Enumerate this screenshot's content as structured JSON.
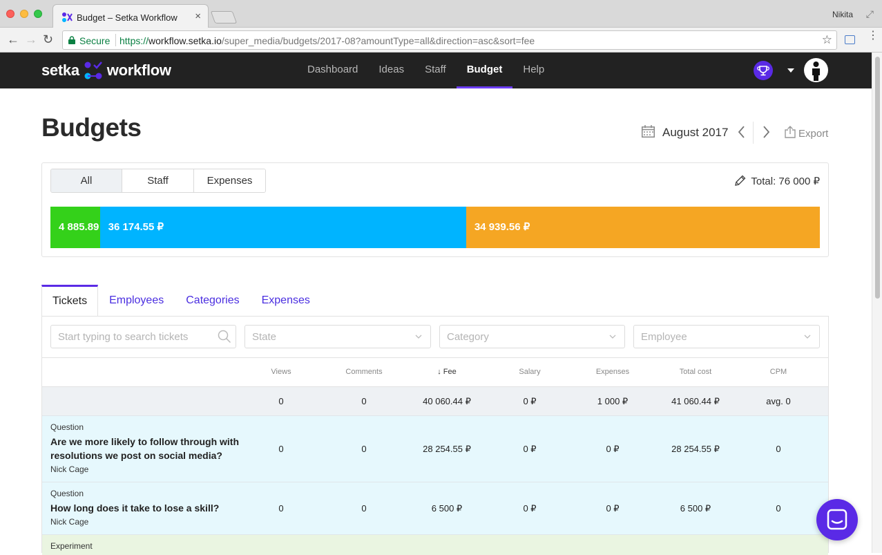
{
  "browser": {
    "tab_title": "Budget – Setka Workflow",
    "tab_close": "×",
    "user_name": "Nikita",
    "secure_label": "Secure",
    "url_scheme": "https://",
    "url_host": "workflow.setka.io",
    "url_path": "/super_media/budgets/2017-08?amountType=all&direction=asc&sort=fee",
    "back_icon": "←",
    "forward_icon": "→",
    "reload_icon": "↻",
    "star_icon": "☆",
    "menu_icon": "⋮",
    "fullscreen_icon": "⤢"
  },
  "header": {
    "logo_left": "setka",
    "logo_right": "workflow",
    "nav": [
      {
        "label": "Dashboard"
      },
      {
        "label": "Ideas"
      },
      {
        "label": "Staff"
      },
      {
        "label": "Budget",
        "active": true
      },
      {
        "label": "Help"
      }
    ],
    "accent_color": "#5a2ae6"
  },
  "page": {
    "title": "Budgets",
    "month": "August 2017",
    "export_label": "Export"
  },
  "summary": {
    "segments": [
      {
        "label": "All",
        "active": true
      },
      {
        "label": "Staff"
      },
      {
        "label": "Expenses"
      }
    ],
    "total_label": "Total: 76 000 ₽",
    "bar": [
      {
        "label": "4 885.89 ₽",
        "value": 4885.89,
        "color": "#34d11a"
      },
      {
        "label": "36 174.55 ₽",
        "value": 36174.55,
        "color": "#00b4ff"
      },
      {
        "label": "34 939.56 ₽",
        "value": 34939.56,
        "color": "#f5a623"
      }
    ]
  },
  "tabs": [
    {
      "label": "Tickets",
      "active": true
    },
    {
      "label": "Employees"
    },
    {
      "label": "Categories"
    },
    {
      "label": "Expenses"
    }
  ],
  "filters": {
    "search_placeholder": "Start typing to search tickets",
    "state_placeholder": "State",
    "category_placeholder": "Category",
    "employee_placeholder": "Employee"
  },
  "table": {
    "columns": [
      "Views",
      "Comments",
      "↓ Fee",
      "Salary",
      "Expenses",
      "Total cost",
      "CPM"
    ],
    "totals": [
      "0",
      "0",
      "40 060.44 ₽",
      "0 ₽",
      "1 000 ₽",
      "41 060.44 ₽",
      "avg. 0"
    ],
    "rows": [
      {
        "type": "Question",
        "title": "Are we more likely to follow through with resolutions we post on social media?",
        "author": "Nick Cage",
        "values": [
          "0",
          "0",
          "28 254.55 ₽",
          "0 ₽",
          "0 ₽",
          "28 254.55 ₽",
          "0"
        ]
      },
      {
        "type": "Question",
        "title": "How long does it take to lose a skill?",
        "author": "Nick Cage",
        "values": [
          "0",
          "0",
          "6 500 ₽",
          "0 ₽",
          "0 ₽",
          "6 500 ₽",
          "0"
        ]
      },
      {
        "type": "Experiment",
        "title": "",
        "author": "",
        "values": []
      }
    ]
  }
}
